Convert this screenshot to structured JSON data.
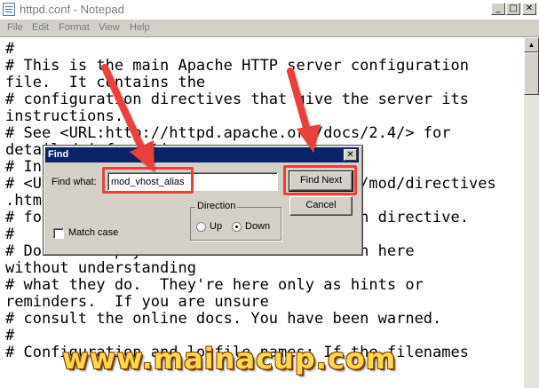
{
  "window": {
    "title": "httpd.conf - Notepad",
    "controls": {
      "minimize": "_",
      "maximize": "□",
      "close": "✕"
    }
  },
  "menu": [
    "File",
    "Edit",
    "Format",
    "View",
    "Help"
  ],
  "editor": {
    "lines": [
      "#",
      "# This is the main Apache HTTP server configuration",
      "file.  It contains the",
      "# configuration directives that give the server its",
      "instructions.",
      "# See <URL:http://httpd.apache.org/docs/2.4/> for",
      "detailed information.",
      "# In particular, see",
      "# <URL:http://httpd.apache.org/docs/2.4/mod/directives",
      ".html>",
      "# for a discussion of each configuration directive.",
      "#",
      "# Do NOT simply read the instructions in here",
      "without understanding",
      "# what they do.  They're here only as hints or",
      "reminders.  If you are unsure",
      "# consult the online docs. You have been warned.",
      "#",
      "# Configuration and logfile names: If the filenames"
    ]
  },
  "find_dialog": {
    "title": "Find",
    "close": "✕",
    "find_what_label": "Find what:",
    "find_what_value": "mod_vhost_alias",
    "find_next_label": "Find Next",
    "cancel_label": "Cancel",
    "match_case_label": "Match case",
    "direction_label": "Direction",
    "direction_up": "Up",
    "direction_down": "Down",
    "direction_selected": "Down"
  },
  "colors": {
    "highlight": "#e8413c",
    "arrow": "#e8413c"
  },
  "watermark": "www.mainacup.com"
}
